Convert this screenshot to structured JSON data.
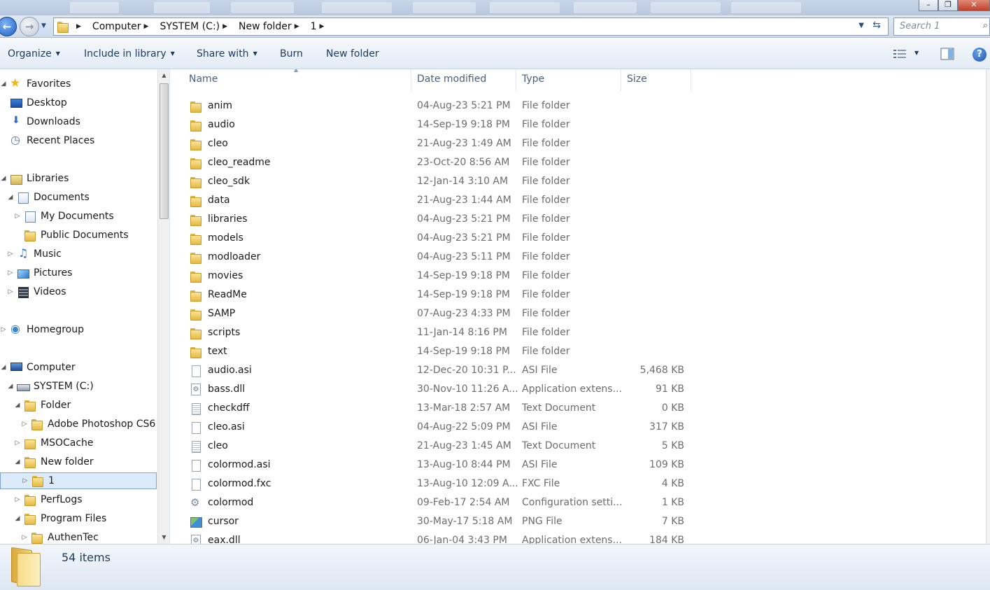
{
  "address": {
    "crumbs": [
      "Computer",
      "SYSTEM (C:)",
      "New folder",
      "1"
    ],
    "search_placeholder": "Search 1"
  },
  "toolbar": {
    "organize": "Organize",
    "include_in_library": "Include in library",
    "share_with": "Share with",
    "burn": "Burn",
    "new_folder": "New folder"
  },
  "nav": {
    "favorites": "Favorites",
    "desktop": "Desktop",
    "downloads": "Downloads",
    "recent_places": "Recent Places",
    "libraries": "Libraries",
    "documents": "Documents",
    "my_documents": "My Documents",
    "public_documents": "Public Documents",
    "music": "Music",
    "pictures": "Pictures",
    "videos": "Videos",
    "homegroup": "Homegroup",
    "computer": "Computer",
    "system_c": "SYSTEM (C:)",
    "folder": "Folder",
    "adobe_photoshop": "Adobe Photoshop CS6",
    "msocache": "MSOCache",
    "new_folder": "New folder",
    "one": "1",
    "perflogs": "PerfLogs",
    "program_files": "Program Files",
    "authentec": "AuthenTec"
  },
  "columns": {
    "name": "Name",
    "date": "Date modified",
    "type": "Type",
    "size": "Size"
  },
  "files": [
    {
      "name": "anim",
      "date": "04-Aug-23 5:21 PM",
      "type": "File folder",
      "size": "",
      "icon": "folder"
    },
    {
      "name": "audio",
      "date": "14-Sep-19 9:18 PM",
      "type": "File folder",
      "size": "",
      "icon": "folder"
    },
    {
      "name": "cleo",
      "date": "21-Aug-23 1:49 AM",
      "type": "File folder",
      "size": "",
      "icon": "folder"
    },
    {
      "name": "cleo_readme",
      "date": "23-Oct-20 8:56 AM",
      "type": "File folder",
      "size": "",
      "icon": "folder"
    },
    {
      "name": "cleo_sdk",
      "date": "12-Jan-14 3:10 AM",
      "type": "File folder",
      "size": "",
      "icon": "folder"
    },
    {
      "name": "data",
      "date": "21-Aug-23 1:44 AM",
      "type": "File folder",
      "size": "",
      "icon": "folder"
    },
    {
      "name": "libraries",
      "date": "04-Aug-23 5:21 PM",
      "type": "File folder",
      "size": "",
      "icon": "folder"
    },
    {
      "name": "models",
      "date": "04-Aug-23 5:21 PM",
      "type": "File folder",
      "size": "",
      "icon": "folder"
    },
    {
      "name": "modloader",
      "date": "04-Aug-23 5:11 PM",
      "type": "File folder",
      "size": "",
      "icon": "folder"
    },
    {
      "name": "movies",
      "date": "14-Sep-19 9:18 PM",
      "type": "File folder",
      "size": "",
      "icon": "folder"
    },
    {
      "name": "ReadMe",
      "date": "14-Sep-19 9:18 PM",
      "type": "File folder",
      "size": "",
      "icon": "folder"
    },
    {
      "name": "SAMP",
      "date": "07-Aug-23 4:33 PM",
      "type": "File folder",
      "size": "",
      "icon": "folder"
    },
    {
      "name": "scripts",
      "date": "11-Jan-14 8:16 PM",
      "type": "File folder",
      "size": "",
      "icon": "folder"
    },
    {
      "name": "text",
      "date": "14-Sep-19 9:18 PM",
      "type": "File folder",
      "size": "",
      "icon": "folder"
    },
    {
      "name": "audio.asi",
      "date": "12-Dec-20 10:31 P...",
      "type": "ASI File",
      "size": "5,468 KB",
      "icon": "file"
    },
    {
      "name": "bass.dll",
      "date": "30-Nov-10 11:26 A...",
      "type": "Application extens...",
      "size": "91 KB",
      "icon": "dll"
    },
    {
      "name": "checkdff",
      "date": "13-Mar-18 2:57 AM",
      "type": "Text Document",
      "size": "0 KB",
      "icon": "text"
    },
    {
      "name": "cleo.asi",
      "date": "04-Aug-22 5:09 PM",
      "type": "ASI File",
      "size": "317 KB",
      "icon": "file"
    },
    {
      "name": "cleo",
      "date": "21-Aug-23 1:45 AM",
      "type": "Text Document",
      "size": "5 KB",
      "icon": "text"
    },
    {
      "name": "colormod.asi",
      "date": "13-Aug-10 8:44 PM",
      "type": "ASI File",
      "size": "109 KB",
      "icon": "file"
    },
    {
      "name": "colormod.fxc",
      "date": "13-Aug-10 12:09 A...",
      "type": "FXC File",
      "size": "4 KB",
      "icon": "file"
    },
    {
      "name": "colormod",
      "date": "09-Feb-17 2:54 AM",
      "type": "Configuration setti...",
      "size": "1 KB",
      "icon": "config"
    },
    {
      "name": "cursor",
      "date": "30-May-17 5:18 AM",
      "type": "PNG File",
      "size": "7 KB",
      "icon": "png"
    },
    {
      "name": "eax.dll",
      "date": "06-Jan-04 3:43 PM",
      "type": "Application extens...",
      "size": "184 KB",
      "icon": "dll"
    }
  ],
  "status": {
    "item_count": "54 items"
  }
}
